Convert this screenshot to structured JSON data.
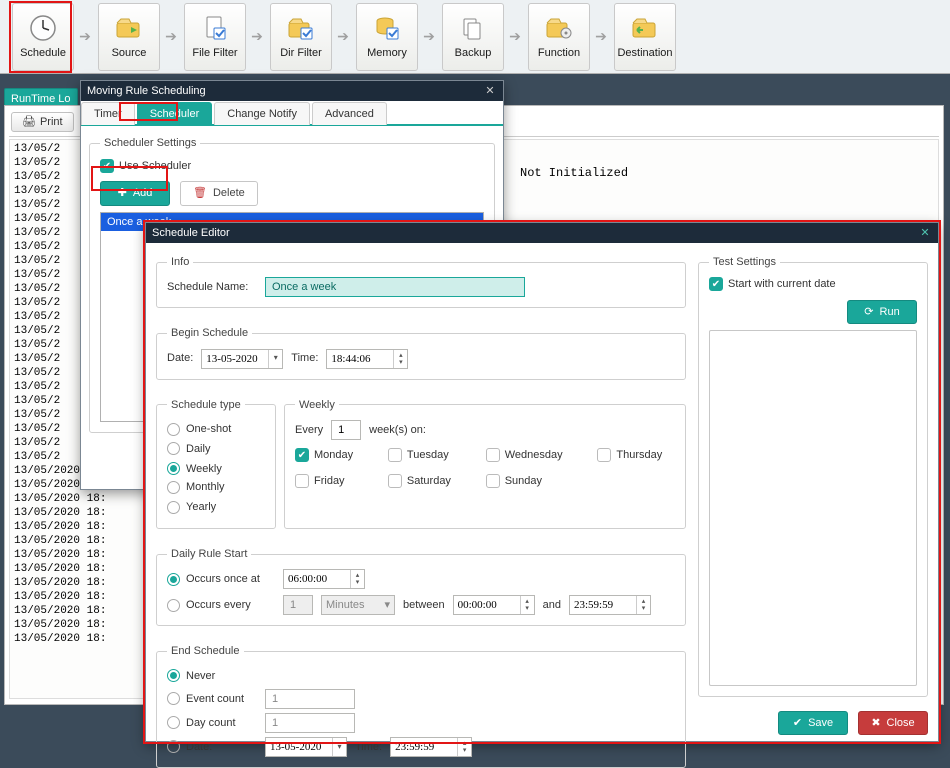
{
  "toolbar": {
    "items": [
      {
        "label": "Schedule",
        "icon": "clock"
      },
      {
        "label": "Source",
        "icon": "folder-in"
      },
      {
        "label": "File Filter",
        "icon": "file-check"
      },
      {
        "label": "Dir Filter",
        "icon": "folder-check"
      },
      {
        "label": "Memory",
        "icon": "db-check"
      },
      {
        "label": "Backup",
        "icon": "files"
      },
      {
        "label": "Function",
        "icon": "folder-fn"
      },
      {
        "label": "Destination",
        "icon": "folder-out"
      }
    ]
  },
  "runtime_tab": "RunTime Lo",
  "print_btn": "Print",
  "not_init": "Not Initialized",
  "log_lines": [
    "13/05/2",
    "13/05/2",
    "13/05/2",
    "13/05/2",
    "13/05/2",
    "13/05/2",
    "13/05/2",
    "13/05/2",
    "13/05/2",
    "13/05/2",
    "13/05/2",
    "13/05/2",
    "13/05/2",
    "13/05/2",
    "13/05/2",
    "13/05/2",
    "13/05/2",
    "13/05/2",
    "13/05/2",
    "13/05/2",
    "13/05/2",
    "13/05/2",
    "13/05/2",
    "13/05/2020 18:",
    "13/05/2020 18:",
    "13/05/2020 18:",
    "13/05/2020 18:",
    "13/05/2020 18:",
    "13/05/2020 18:",
    "13/05/2020 18:",
    "13/05/2020 18:",
    "13/05/2020 18:",
    "13/05/2020 18:",
    "13/05/2020 18:",
    "13/05/2020 18:",
    "13/05/2020 18:"
  ],
  "sched_win": {
    "title": "Moving Rule Scheduling",
    "tabs": {
      "timer": "Timer",
      "scheduler": "Scheduler",
      "change": "Change Notify",
      "advanced": "Advanced"
    },
    "grp": "Scheduler Settings",
    "use": "Use Scheduler",
    "add": "Add",
    "delete": "Delete",
    "list_item": "Once a week"
  },
  "editor": {
    "title": "Schedule Editor",
    "info": "Info",
    "name_lbl": "Schedule Name:",
    "name_val": "Once a week",
    "begin": "Begin Schedule",
    "date_lbl": "Date:",
    "date_val": "13-05-2020",
    "time_lbl": "Time:",
    "time_val": "18:44:06",
    "type": "Schedule type",
    "types": {
      "one": "One-shot",
      "daily": "Daily",
      "weekly": "Weekly",
      "monthly": "Monthly",
      "yearly": "Yearly"
    },
    "weekly": "Weekly",
    "every_pre": "Every",
    "every_val": "1",
    "every_suf": "week(s) on:",
    "days": {
      "mon": "Monday",
      "tue": "Tuesday",
      "wed": "Wednesday",
      "thu": "Thursday",
      "fri": "Friday",
      "sat": "Saturday",
      "sun": "Sunday"
    },
    "daily": "Daily Rule Start",
    "occ_once": "Occurs once at",
    "occ_once_val": "06:00:00",
    "occ_every": "Occurs every",
    "occ_every_val": "1",
    "occ_every_unit": "Minutes",
    "between": "between",
    "between_a": "00:00:00",
    "and": "and",
    "between_b": "23:59:59",
    "end": "End Schedule",
    "never": "Never",
    "evcount": "Event count",
    "evcount_val": "1",
    "daycount": "Day count",
    "daycount_val": "1",
    "end_date": "Date:",
    "end_date_val": "13-05-2020",
    "end_time_lbl": "Time:",
    "end_time_val": "23:59:59",
    "test": "Test Settings",
    "start_cur": "Start with current date",
    "run": "Run",
    "save": "Save",
    "close": "Close"
  }
}
